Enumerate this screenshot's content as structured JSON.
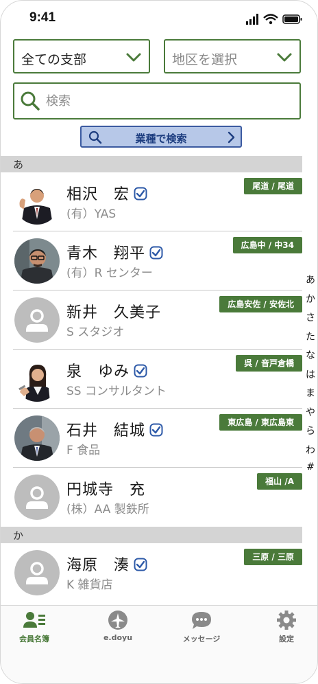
{
  "status_bar": {
    "time": "9:41"
  },
  "filters": {
    "branch_value": "全ての支部",
    "region_placeholder": "地区を選択"
  },
  "search": {
    "placeholder": "検索"
  },
  "industry_button": {
    "label": "業種で検索"
  },
  "sections": [
    {
      "header": "あ",
      "members": [
        {
          "name": "相沢　宏",
          "verified": true,
          "company": "(有）YAS",
          "region": "尾道 / 尾道",
          "avatar": "photo-suit-thumbsup"
        },
        {
          "name": "青木　翔平",
          "verified": true,
          "company": "(有）R センター",
          "region": "広島中 / 中34",
          "avatar": "photo-glasses"
        },
        {
          "name": "新井　久美子",
          "verified": false,
          "company": "S スタジオ",
          "region": "広島安佐 / 安佐北",
          "avatar": "placeholder"
        },
        {
          "name": "泉　ゆみ",
          "verified": true,
          "company": "SS コンサルタント",
          "region": "呉 / 音戸倉橋",
          "avatar": "photo-woman"
        },
        {
          "name": "石井　結城",
          "verified": true,
          "company": "F 食品",
          "region": "東広島 / 東広島東",
          "avatar": "photo-senior"
        },
        {
          "name": "円城寺　充",
          "verified": false,
          "company": "(株）AA 製鉄所",
          "region": "福山 /A",
          "avatar": "placeholder"
        }
      ]
    },
    {
      "header": "か",
      "members": [
        {
          "name": "海原　湊",
          "verified": true,
          "company": "K 雑貨店",
          "region": "三原 / 三原",
          "avatar": "placeholder"
        }
      ]
    }
  ],
  "index_letters": [
    "あ",
    "か",
    "さ",
    "た",
    "な",
    "は",
    "ま",
    "や",
    "ら",
    "わ",
    "#"
  ],
  "tabs": [
    {
      "label": "会員名簿",
      "icon": "members-icon",
      "active": true
    },
    {
      "label": "e.doyu",
      "icon": "edoyu-logo-icon",
      "active": false
    },
    {
      "label": "メッセージ",
      "icon": "message-icon",
      "active": false
    },
    {
      "label": "設定",
      "icon": "gear-icon",
      "active": false
    }
  ],
  "colors": {
    "accent_green": "#4a7a3a",
    "industry_blue": "#b7c8e8",
    "industry_border": "#3b5aa0"
  }
}
